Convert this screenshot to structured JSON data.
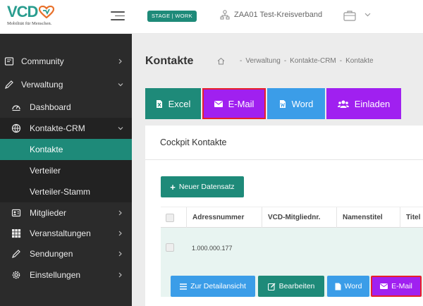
{
  "header": {
    "logo_text": "VCD",
    "logo_tagline": "Mobilität für Menschen.",
    "stage_badge": "STAGE | WORK",
    "organization": "ZAA01 Test-Kreisverband"
  },
  "sidebar": {
    "items": [
      {
        "label": "Community",
        "icon": "community-icon"
      },
      {
        "label": "Verwaltung",
        "icon": "pencil-icon"
      },
      {
        "label": "Dashboard",
        "icon": "dashboard-icon"
      },
      {
        "label": "Kontakte-CRM",
        "icon": "globe-icon"
      },
      {
        "label": "Kontakte"
      },
      {
        "label": "Verteiler"
      },
      {
        "label": "Verteiler-Stamm"
      },
      {
        "label": "Mitglieder",
        "icon": "members-icon"
      },
      {
        "label": "Veranstaltungen",
        "icon": "grid-icon"
      },
      {
        "label": "Sendungen",
        "icon": "pencil-icon"
      },
      {
        "label": "Einstellungen",
        "icon": "gear-icon"
      }
    ]
  },
  "page": {
    "title": "Kontakte",
    "breadcrumb": [
      "Verwaltung",
      "Kontakte-CRM",
      "Kontakte"
    ]
  },
  "actions": {
    "excel": "Excel",
    "email": "E-Mail",
    "word": "Word",
    "invite": "Einladen"
  },
  "card": {
    "title": "Cockpit Kontakte",
    "new_button": "Neuer Datensatz"
  },
  "table": {
    "columns": [
      "Adressnummer",
      "VCD-Mitgliednr.",
      "Namenstitel",
      "Titel"
    ],
    "rows": [
      {
        "adressnummer": "1.000.000.177"
      }
    ]
  },
  "row_actions": {
    "details": "Zur Detailansicht",
    "edit": "Bearbeiten",
    "word": "Word",
    "email": "E-Mail"
  },
  "colors": {
    "teal": "#1e8a79",
    "purple": "#a020f0",
    "blue": "#3b9de8",
    "highlight_red": "#e8202a",
    "sidebar_bg": "#2b2b2b"
  }
}
